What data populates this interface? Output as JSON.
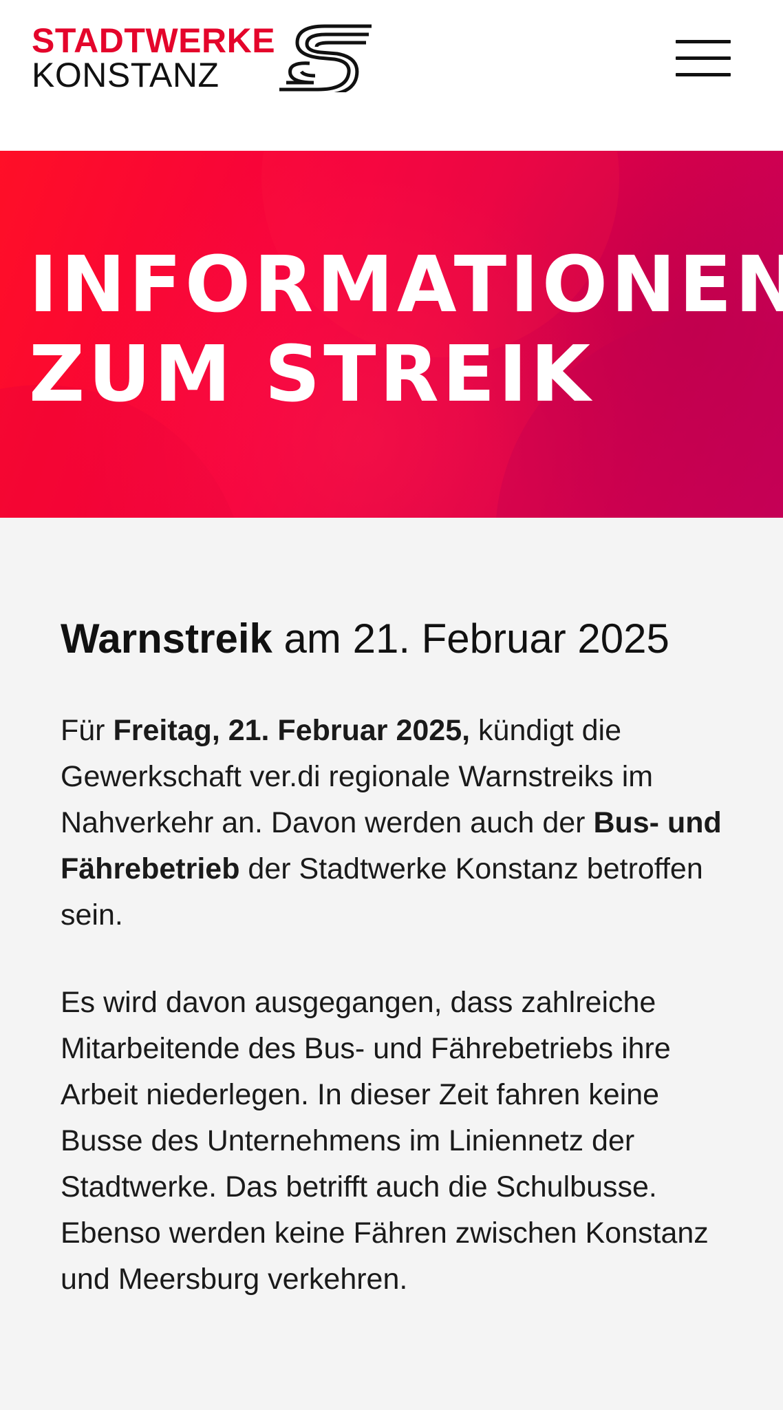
{
  "header": {
    "logo_line1": "STADTWERKE",
    "logo_line2": "KONSTANZ",
    "menu_icon": "hamburger-menu-icon"
  },
  "hero": {
    "title_line1": "INFORMATIONEN",
    "title_line2": "ZUM STREIK"
  },
  "article": {
    "heading_bold": "Warnstreik",
    "heading_rest": " am 21. Februar 2025",
    "p1": {
      "t1": "Für ",
      "b1": "Freitag, 21. Februar 2025,",
      "t2": " kündigt die Gewerkschaft ver.di regionale Warnstreiks im Nahverkehr an. Davon werden auch der ",
      "b2": "Bus- und Fährebetrieb",
      "t3": " der Stadtwerke Konstanz  betroffen sein."
    },
    "p2": "Es wird davon ausgegangen, dass zahlreiche Mitarbeitende des Bus- und Fährebetriebs ihre Arbeit niederlegen. In dieser Zeit fahren keine Busse des Unternehmens im Liniennetz der Stadtwerke. Das betrifft auch die Schulbusse. Ebenso werden keine Fähren zwischen Konstanz und Meersburg verkehren."
  },
  "colors": {
    "brand_red": "#e4052b",
    "hero_start": "#ff0f27",
    "hero_end": "#c8005a",
    "content_bg": "#f4f4f4"
  }
}
